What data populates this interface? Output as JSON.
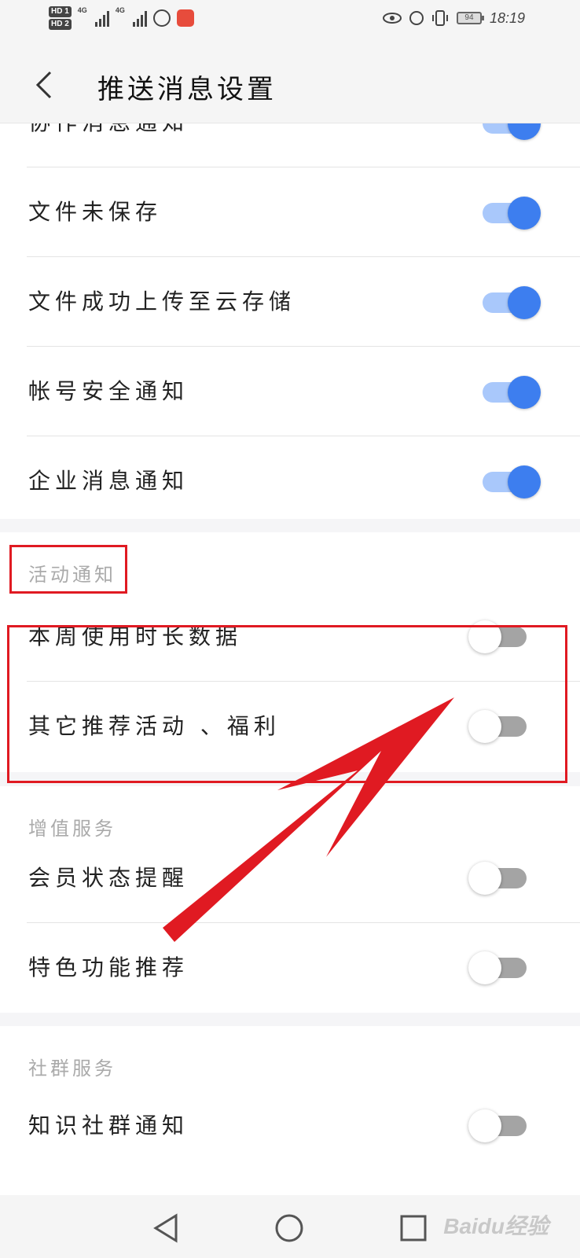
{
  "status_bar": {
    "hd1": "HD 1",
    "hd2": "HD 2",
    "net1": "4G",
    "net2": "4G",
    "battery": "94",
    "time": "18:19"
  },
  "header": {
    "title": "推送消息设置"
  },
  "partial_row": {
    "label": "协作消息通知",
    "on": true
  },
  "group_top": [
    {
      "label": "文件未保存",
      "on": true
    },
    {
      "label": "文件成功上传至云存储",
      "on": true
    },
    {
      "label": "帐号安全通知",
      "on": true
    },
    {
      "label": "企业消息通知",
      "on": true
    }
  ],
  "section_activity": {
    "title": "活动通知",
    "items": [
      {
        "label": "本周使用时长数据",
        "on": false
      },
      {
        "label": "其它推荐活动 、福利",
        "on": false
      }
    ]
  },
  "section_value": {
    "title": "增值服务",
    "items": [
      {
        "label": "会员状态提醒",
        "on": false
      },
      {
        "label": "特色功能推荐",
        "on": false
      }
    ]
  },
  "section_social": {
    "title": "社群服务",
    "items": [
      {
        "label": "知识社群通知",
        "on": false
      }
    ]
  },
  "watermark": "Baidu经验",
  "colors": {
    "toggle_on_knob": "#3d7eef",
    "toggle_on_track": "#a9c8fb",
    "toggle_off_track": "#a4a4a4",
    "annotation_red": "#e01a22"
  }
}
